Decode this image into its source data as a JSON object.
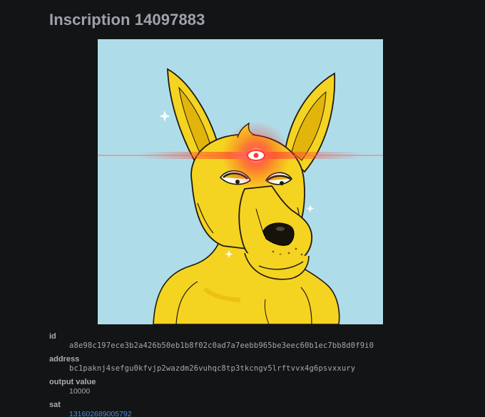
{
  "page": {
    "title": "Inscription 14097883"
  },
  "artwork": {
    "icon": "kangaroo-portrait-image",
    "colors": {
      "background": "#aedde9",
      "fur": "#f5d321",
      "fur_shadow": "#e2b50c",
      "outline": "#1d1a10",
      "laser": "#ff3b2e"
    }
  },
  "details": {
    "id_label": "id",
    "id_value": "a8e98c197ece3b2a426b50eb1b8f02c0ad7a7eebb965be3eec60b1ec7bb8d0f9i0",
    "address_label": "address",
    "address_value": "bc1paknj4sefgu0kfvjp2wazdm26vuhqc8tp3tkcngv5lrftvvx4g6psvxxury",
    "output_value_label": "output value",
    "output_value_value": "10000",
    "sat_label": "sat",
    "sat_value": "131602689005792"
  }
}
